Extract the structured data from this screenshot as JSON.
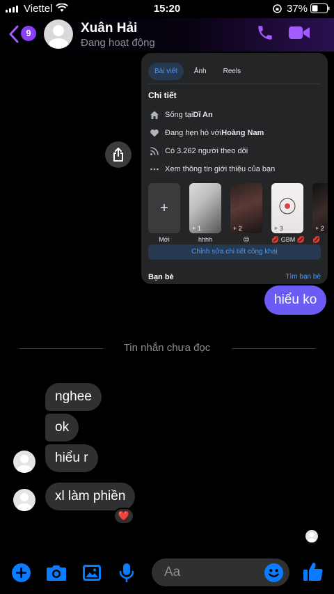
{
  "status_bar": {
    "carrier": "Viettel",
    "time": "15:20",
    "battery": "37%"
  },
  "header": {
    "back_badge": "9",
    "contact_name": "Xuân Hải",
    "contact_status": "Đang hoạt động",
    "accent_color": "#a35cff"
  },
  "shared_card": {
    "tabs": [
      "Bài viết",
      "Ảnh",
      "Reels"
    ],
    "active_tab": "Bài viết",
    "section_title": "Chi tiết",
    "details": [
      {
        "icon": "home-icon",
        "prefix": "Sống tại ",
        "bold": "Dĩ An"
      },
      {
        "icon": "heart-icon",
        "prefix": "Đang hẹn hò với ",
        "bold": "Hoàng Nam"
      },
      {
        "icon": "rss-icon",
        "prefix": "Có 3.262 người theo dõi",
        "bold": ""
      },
      {
        "icon": "more-icon",
        "prefix": "Xem thông tin giới thiệu của bạn",
        "bold": ""
      }
    ],
    "highlights": [
      {
        "label": "Mới",
        "count": ""
      },
      {
        "label": "hhhh",
        "count": "+ 1"
      },
      {
        "label": "😔",
        "count": "+ 2"
      },
      {
        "label": "💋 GBM 💋",
        "count": "+ 3"
      },
      {
        "label": "💋",
        "count": "+ 2"
      }
    ],
    "edit_button": "Chỉnh sửa chi tiết công khai",
    "friends_label": "Bạn bè",
    "friends_link": "Tìm bạn bè"
  },
  "messages": {
    "outgoing": [
      {
        "text": "hiểu ko"
      }
    ],
    "unread_divider": "Tin nhắn chưa đọc",
    "incoming": [
      {
        "text": "nghee"
      },
      {
        "text": "ok"
      },
      {
        "text": "hiểu r"
      },
      {
        "text": "xl làm phiền"
      }
    ],
    "reaction": "❤️"
  },
  "composer": {
    "placeholder": "Aa",
    "icon_color": "#0a7cff"
  }
}
